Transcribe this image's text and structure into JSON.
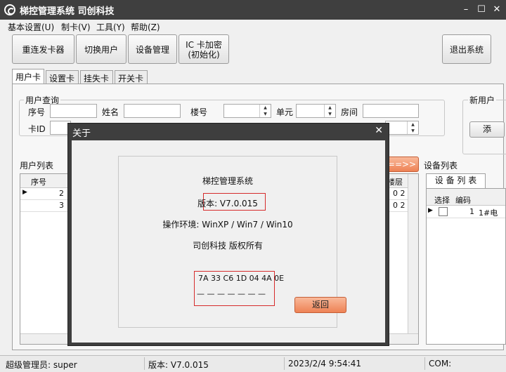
{
  "window": {
    "title": "梯控管理系统  司创科技",
    "min": "–",
    "max": "☐",
    "close": "✕"
  },
  "menu": [
    "基本设置(U)",
    "制卡(V)",
    "工具(Y)",
    "帮助(Z)"
  ],
  "toolbar": {
    "reconnect": "重连发卡器",
    "switch_user": "切换用户",
    "device_mgmt": "设备管理",
    "ic_encrypt_1": "IC 卡加密",
    "ic_encrypt_2": "(初始化)",
    "exit": "退出系统"
  },
  "tabs": [
    "用户卡",
    "设置卡",
    "挂失卡",
    "开关卡"
  ],
  "query": {
    "title": "用户查询",
    "seq": "序号",
    "name": "姓名",
    "building": "楼号",
    "unit": "单元",
    "room": "房间",
    "card_id": "卡ID"
  },
  "new_user": {
    "title": "新用户",
    "btn": "添"
  },
  "user_list": {
    "title": "用户列表",
    "col_seq": "序号",
    "rows": [
      {
        "seq": "2",
        "tail": "0 2"
      },
      {
        "seq": "3",
        "tail": "0 2"
      }
    ],
    "col_floor": "楼层"
  },
  "transfer_btn": "==>>",
  "device_list": {
    "title": "设备列表",
    "tab": "设 备 列 表",
    "col_select": "选择",
    "col_code": "编码",
    "rows": [
      {
        "code": "1",
        "name": "1#电"
      }
    ]
  },
  "dialog": {
    "title": "关于",
    "close": "✕",
    "app_name": "梯控管理系统",
    "version": "版本: V7.0.015",
    "env": "操作环境: WinXP / Win7 / Win10",
    "copyright": "司创科技 版权所有",
    "code": "7A 33 C6 1D 04 4A 0E",
    "dashes": "— — — — — — —",
    "back": "返回"
  },
  "status": {
    "admin": "超级管理员: super",
    "version": "版本: V7.0.015",
    "datetime": "2023/2/4 9:54:41",
    "com": "COM:"
  }
}
